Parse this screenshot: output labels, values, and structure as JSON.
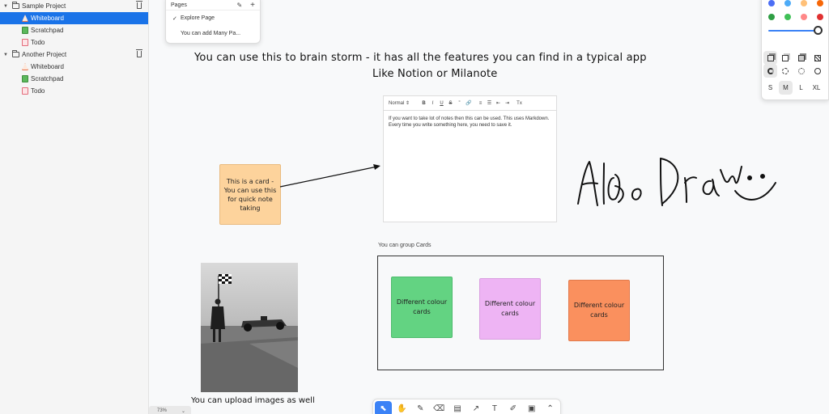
{
  "sidebar": {
    "projects": [
      {
        "name": "Sample Project",
        "children": [
          "Whiteboard",
          "Scratchpad",
          "Todo"
        ]
      },
      {
        "name": "Another Project",
        "children": [
          "Whiteboard",
          "Scratchpad",
          "Todo"
        ]
      }
    ]
  },
  "pages_panel": {
    "title": "Pages",
    "items": [
      "Explore Page",
      "You can add Many Pa..."
    ]
  },
  "canvas": {
    "headline_line1": "You can use this to brain storm - it has all the features you can find in a typical app",
    "headline_line2": "Like Notion or Milanote",
    "note_card": "This is a card - You can use this for quick note taking",
    "editor": {
      "format": "Normal",
      "format_caret": "⇕",
      "buttons": [
        "B",
        "I",
        "U",
        "S",
        "”",
        "🔗",
        "≡",
        "☰",
        "⇤",
        "⇥",
        "Tx"
      ],
      "text": "If you want to take lot of notes then this can be used. This uses Markdown. Every time you write something here, you need to save it."
    },
    "group_label": "You can group Cards",
    "cards": [
      "Different colour cards",
      "Different colour cards",
      "Different colour cards"
    ],
    "photo_caption": "You can upload images as well"
  },
  "zoom": {
    "value": "73%",
    "caret": "⌄"
  },
  "toolbar": {
    "tools": [
      {
        "name": "select",
        "glyph": "⬉"
      },
      {
        "name": "hand",
        "glyph": "✋"
      },
      {
        "name": "draw",
        "glyph": "✎"
      },
      {
        "name": "eraser",
        "glyph": "⌫"
      },
      {
        "name": "note",
        "glyph": "▤"
      },
      {
        "name": "arrow",
        "glyph": "↗"
      },
      {
        "name": "text",
        "glyph": "T"
      },
      {
        "name": "edit",
        "glyph": "✐"
      },
      {
        "name": "image",
        "glyph": "▣"
      },
      {
        "name": "more",
        "glyph": "⌃"
      }
    ]
  },
  "style_panel": {
    "colors_row1": [
      "#4c6ef5",
      "#4dabf7",
      "#ffc078",
      "#f76707"
    ],
    "colors_row2": [
      "#2f9e44",
      "#40c057",
      "#ff8787",
      "#e03131"
    ],
    "sizes": [
      "S",
      "M",
      "L",
      "XL"
    ]
  },
  "colors": {
    "accent": "#1a73e8",
    "note_card": "#fdd39c",
    "green_card": "#63d382",
    "pink_card": "#eeb4f4",
    "orange_card": "#fa905e"
  }
}
